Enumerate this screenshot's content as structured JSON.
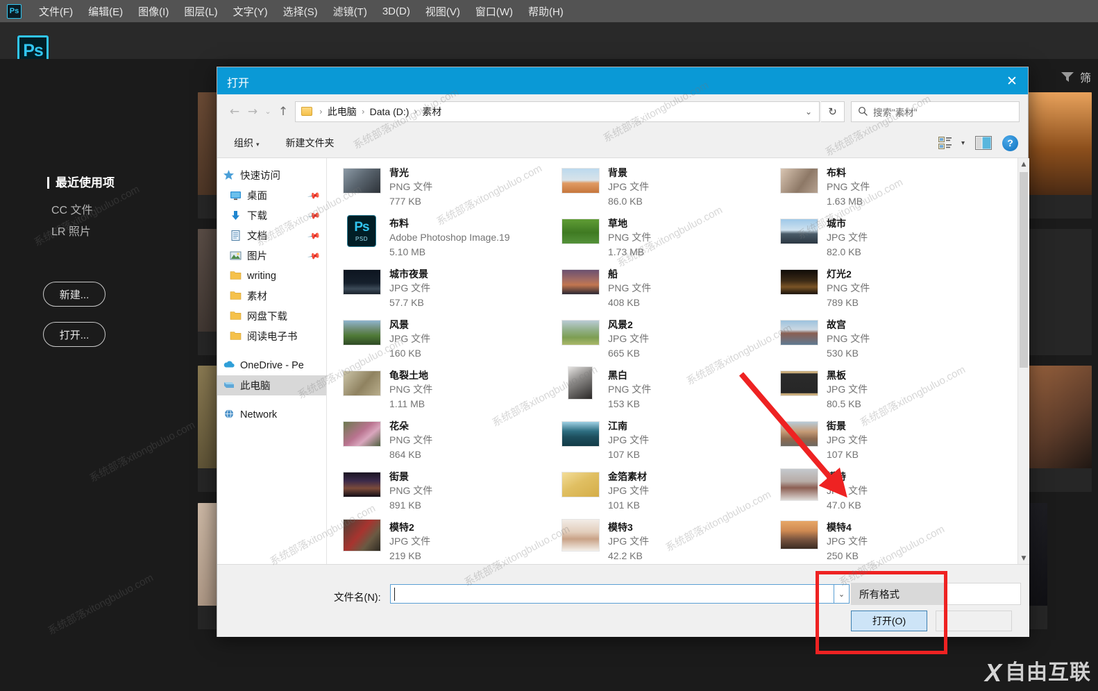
{
  "app": {
    "name": "Adobe Photoshop",
    "logo_text": "Ps",
    "menus": [
      {
        "label": "文件(F)"
      },
      {
        "label": "编辑(E)"
      },
      {
        "label": "图像(I)"
      },
      {
        "label": "图层(L)"
      },
      {
        "label": "文字(Y)"
      },
      {
        "label": "选择(S)"
      },
      {
        "label": "滤镜(T)"
      },
      {
        "label": "3D(D)"
      },
      {
        "label": "视图(V)"
      },
      {
        "label": "窗口(W)"
      },
      {
        "label": "帮助(H)"
      }
    ],
    "start_screen": {
      "recent_title": "最近使用项",
      "nav_items": [
        {
          "label": "CC 文件"
        },
        {
          "label": "LR 照片"
        }
      ],
      "buttons": [
        {
          "label": "新建..."
        },
        {
          "label": "打开..."
        }
      ],
      "filter_label": "筛"
    }
  },
  "dialog": {
    "title": "打开",
    "close_label": "✕",
    "nav": {
      "back": "←",
      "forward": "→",
      "history": "⌄",
      "up": "↑",
      "breadcrumbs": [
        "此电脑",
        "Data (D:)",
        "素材"
      ],
      "breadcrumb_separator": "›",
      "address_chevron": "⌄",
      "refresh": "↻",
      "search_placeholder": "搜索\"素材\""
    },
    "toolbar": {
      "organize": "组织",
      "organize_caret": "▾",
      "new_folder": "新建文件夹",
      "view_caret": "▾",
      "help": "?"
    },
    "nav_pane": [
      {
        "label": "快速访问",
        "icon": "star-icon",
        "pinned": false,
        "selected": false,
        "root": true
      },
      {
        "label": "桌面",
        "icon": "desktop-icon",
        "pinned": true,
        "selected": false,
        "root": false
      },
      {
        "label": "下载",
        "icon": "download-icon",
        "pinned": true,
        "selected": false,
        "root": false
      },
      {
        "label": "文档",
        "icon": "document-icon",
        "pinned": true,
        "selected": false,
        "root": false
      },
      {
        "label": "图片",
        "icon": "picture-icon",
        "pinned": true,
        "selected": false,
        "root": false
      },
      {
        "label": "writing",
        "icon": "folder-icon",
        "pinned": false,
        "selected": false,
        "root": false
      },
      {
        "label": "素材",
        "icon": "folder-icon",
        "pinned": false,
        "selected": false,
        "root": false
      },
      {
        "label": "网盘下载",
        "icon": "folder-icon",
        "pinned": false,
        "selected": false,
        "root": false
      },
      {
        "label": "阅读电子书",
        "icon": "folder-icon",
        "pinned": false,
        "selected": false,
        "root": false
      },
      {
        "label": "OneDrive - Pe",
        "icon": "onedrive-icon",
        "pinned": false,
        "selected": false,
        "root": true,
        "gap_before": true
      },
      {
        "label": "此电脑",
        "icon": "computer-icon",
        "pinned": false,
        "selected": true,
        "root": true
      },
      {
        "label": "Network",
        "icon": "network-icon",
        "pinned": false,
        "selected": false,
        "root": true,
        "gap_before": true
      }
    ],
    "files": [
      {
        "name": "背光",
        "type": "PNG 文件",
        "size": "777 KB",
        "icon": "image-thumb",
        "swatch": "linear-gradient(135deg,#8c9aa6,#5b6670 45%,#2d3238)"
      },
      {
        "name": "背景",
        "type": "JPG 文件",
        "size": "86.0 KB",
        "icon": "image-thumb",
        "swatch": "linear-gradient(#bcd9ee 0%,#d8e3e9 48%,#e09a62 60%,#c6763c 100%)"
      },
      {
        "name": "布料",
        "type": "PNG 文件",
        "size": "1.63 MB",
        "icon": "image-thumb",
        "swatch": "linear-gradient(125deg,#d9c5b2,#8d7866 60%,#b6a291)"
      },
      {
        "name": "布料",
        "type": "Adobe Photoshop Image.19",
        "size": "5.10 MB",
        "icon": "psd-icon",
        "swatch": ""
      },
      {
        "name": "草地",
        "type": "PNG 文件",
        "size": "1.73 MB",
        "icon": "image-thumb",
        "swatch": "linear-gradient(#5f9c35,#3f7a22 55%,#54923a)"
      },
      {
        "name": "城市",
        "type": "JPG 文件",
        "size": "82.0 KB",
        "icon": "image-thumb",
        "swatch": "linear-gradient(#9ec8e8 0%,#cfe2ef 45%,#4a5b68 60%,#2b3742 100%)"
      },
      {
        "name": "城市夜景",
        "type": "JPG 文件",
        "size": "57.7 KB",
        "icon": "image-thumb",
        "swatch": "linear-gradient(#0d1520 0%,#16202c 55%,#3c4a58 78%,#1a222b 100%)"
      },
      {
        "name": "船",
        "type": "PNG 文件",
        "size": "408 KB",
        "icon": "image-thumb",
        "swatch": "linear-gradient(#6b5070 0%,#a26b63 40%,#c2764f 62%,#2a2733 100%)"
      },
      {
        "name": "灯光2",
        "type": "PNG 文件",
        "size": "789 KB",
        "icon": "image-thumb",
        "swatch": "linear-gradient(#100c08 0%,#3c2a16 45%,#7a5426 70%,#1a130c 100%)"
      },
      {
        "name": "风景",
        "type": "JPG 文件",
        "size": "160 KB",
        "icon": "image-thumb",
        "swatch": "linear-gradient(#8fb5cf 0%,#6e8d74 35%,#4f7a37 62%,#2f4a25 100%)"
      },
      {
        "name": "风景2",
        "type": "JPG 文件",
        "size": "665 KB",
        "icon": "image-thumb",
        "swatch": "linear-gradient(#b9cbd5 0%,#8fae83 42%,#7d9e52 70%,#aab86a 100%)"
      },
      {
        "name": "故宫",
        "type": "PNG 文件",
        "size": "530 KB",
        "icon": "image-thumb",
        "swatch": "linear-gradient(#9dc2de 0%,#cbd8e2 38%,#8a5f52 52%,#5f7a92 100%)"
      },
      {
        "name": "龟裂土地",
        "type": "PNG 文件",
        "size": "1.11 MB",
        "icon": "image-thumb",
        "swatch": "linear-gradient(130deg,#cbc4a8,#8f8260 55%,#b9ae8c)"
      },
      {
        "name": "黑白",
        "type": "PNG 文件",
        "size": "153 KB",
        "icon": "image-thumb-portrait",
        "swatch": "linear-gradient(150deg,#e6e4e2,#8c8a88 40%,#2a2827)"
      },
      {
        "name": "黑板",
        "type": "JPG 文件",
        "size": "80.5 KB",
        "icon": "image-thumb",
        "swatch": "linear-gradient(#c8ab7a 0%,#c8ab7a 8%,#2b2b2b 10%,#262626 90%,#c8ab7a 92%)"
      },
      {
        "name": "花朵",
        "type": "PNG 文件",
        "size": "864 KB",
        "icon": "image-thumb",
        "swatch": "linear-gradient(140deg,#6b7a4e,#b9738f 45%,#d9a6bd 65%,#4f6040)"
      },
      {
        "name": "江南",
        "type": "JPG 文件",
        "size": "107 KB",
        "icon": "image-thumb",
        "swatch": "linear-gradient(#9fd0e4 0%,#2f6f82 38%,#1d4f5e 62%,#133b47 100%)"
      },
      {
        "name": "街景",
        "type": "JPG 文件",
        "size": "107 KB",
        "icon": "image-thumb",
        "swatch": "linear-gradient(#b8cbd8 0%,#c59b76 40%,#8e6a4f 70%,#6d6a62 100%)"
      },
      {
        "name": "街景",
        "type": "PNG 文件",
        "size": "891 KB",
        "icon": "image-thumb",
        "swatch": "linear-gradient(#1a1422 0%,#3c2a4a 35%,#7c4b3a 65%,#120d16 100%)"
      },
      {
        "name": "金箔素材",
        "type": "JPG 文件",
        "size": "101 KB",
        "icon": "image-thumb",
        "swatch": "linear-gradient(150deg,#f3dd9a,#e0bf62 45%,#d4ad48)"
      },
      {
        "name": "模特",
        "type": "JPG 文件",
        "size": "47.0 KB",
        "icon": "image-thumb",
        "swatch": "linear-gradient(#c5c9cd 0%,#b7aba6 40%,#8c5f53 60%,#dedad7 100%)"
      },
      {
        "name": "模特2",
        "type": "JPG 文件",
        "size": "219 KB",
        "icon": "image-thumb",
        "swatch": "linear-gradient(130deg,#4a4036,#a8342f 45%,#6a5a43 70%,#2e2a22)"
      },
      {
        "name": "模特3",
        "type": "JPG 文件",
        "size": "42.2 KB",
        "icon": "image-thumb",
        "swatch": "linear-gradient(#f2ece6 0%,#e2cdbb 40%,#c9a287 62%,#f4efe9 100%)"
      },
      {
        "name": "模特4",
        "type": "JPG 文件",
        "size": "250 KB",
        "icon": "image-thumb",
        "swatch": "linear-gradient(#e7a767 0%,#cf8a52 35%,#7c5640 65%,#3b2b22 100%)"
      }
    ],
    "scrollbar": {
      "up": "▲",
      "down": "▼"
    },
    "bottom": {
      "filename_label": "文件名(N):",
      "filename_value": "",
      "filename_dropdown": "⌄",
      "filetype_value": "所有格式",
      "open_button": "打开(O)",
      "cancel_button": ""
    }
  },
  "watermarks": {
    "text": "系统部落xitongbuluo.com",
    "brand_mark": "X",
    "brand_text": "自由互联"
  },
  "colors": {
    "dialog_titlebar": "#0a99d6",
    "selection_blue": "#cfe8fb",
    "annotation_red": "#ee2222",
    "ps_accent": "#31c5f0"
  }
}
